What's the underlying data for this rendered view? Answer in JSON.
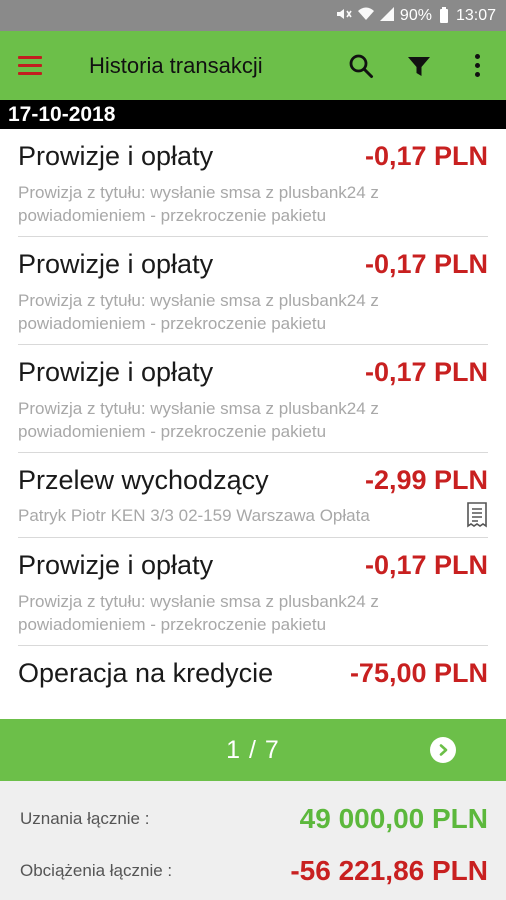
{
  "status_bar": {
    "battery": "90%",
    "time": "13:07",
    "icons": [
      "mute-icon",
      "wifi-icon",
      "signal-icon",
      "battery-icon"
    ]
  },
  "app_bar": {
    "title": "Historia transakcji",
    "icons": [
      "menu-icon",
      "search-icon",
      "filter-icon",
      "more-icon"
    ],
    "menu_color": "#c21f1f",
    "background": "#6cbf49"
  },
  "date_header": "17-10-2018",
  "transactions": [
    {
      "title": "Prowizje i opłaty",
      "amount": "-0,17 PLN",
      "desc_line1": "Prowizja z tytułu: wysłanie smsa z plusbank24 z",
      "desc_line2": "powiadomieniem - przekroczenie pakietu"
    },
    {
      "title": "Prowizje i opłaty",
      "amount": "-0,17 PLN",
      "desc_line1": "Prowizja z tytułu: wysłanie smsa z plusbank24 z",
      "desc_line2": "powiadomieniem - przekroczenie pakietu"
    },
    {
      "title": "Prowizje i opłaty",
      "amount": "-0,17 PLN",
      "desc_line1": "Prowizja z tytułu: wysłanie smsa z plusbank24 z",
      "desc_line2": "powiadomieniem - przekroczenie pakietu"
    },
    {
      "title": "Przelew wychodzący",
      "amount": "-2,99 PLN",
      "desc_line1": "Patryk Piotr KEN 3/3 02-159 Warszawa  Opłata",
      "icon": "receipt-icon"
    },
    {
      "title": "Prowizje i opłaty",
      "amount": "-0,17 PLN",
      "desc_line1": "Prowizja z tytułu: wysłanie smsa z plusbank24 z",
      "desc_line2": "powiadomieniem - przekroczenie pakietu"
    },
    {
      "title": "Operacja na kredycie",
      "amount": "-75,00 PLN"
    }
  ],
  "pager": {
    "text": "1 / 7",
    "next_icon": "chevron-right-icon"
  },
  "summary": {
    "credit_label": "Uznania łącznie :",
    "credit_value": "49 000,00 PLN",
    "debit_label": "Obciążenia łącznie :",
    "debit_value": "-56 221,86 PLN",
    "credit_color": "#5cb83c",
    "debit_color": "#c82020"
  }
}
